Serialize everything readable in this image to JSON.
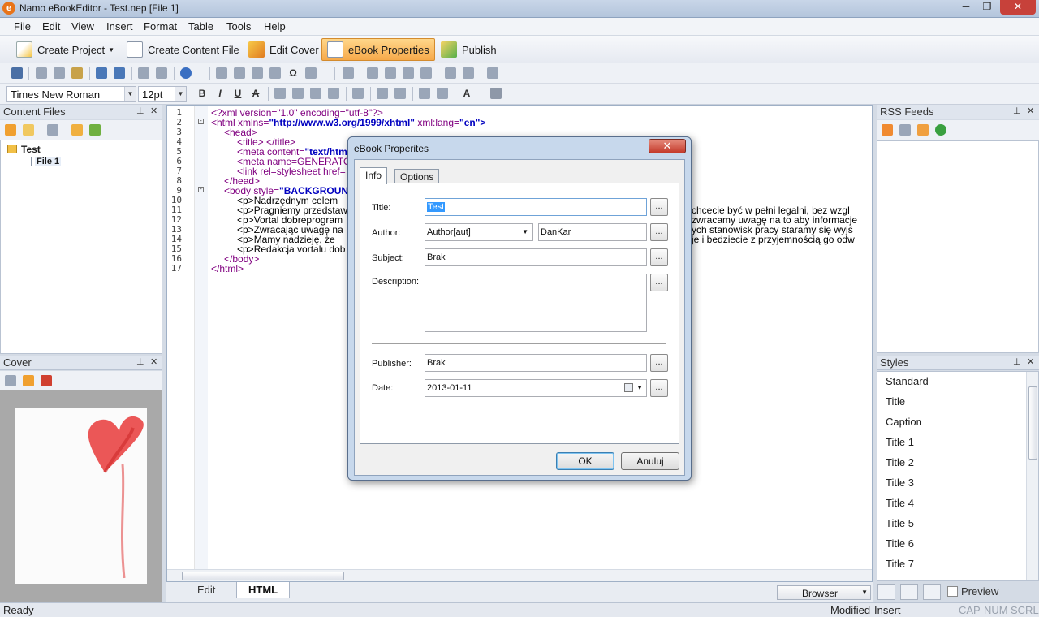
{
  "window": {
    "title": "Namo eBookEditor - Test.nep [File 1]",
    "app_icon_glyph": "e",
    "controls": [
      "─",
      "❐",
      "✕"
    ]
  },
  "menu": [
    "File",
    "Edit",
    "View",
    "Insert",
    "Format",
    "Table",
    "Tools",
    "Help"
  ],
  "toolbar": {
    "create_project": "Create Project",
    "create_content": "Create Content File",
    "edit_cover": "Edit Cover",
    "ebook_properties": "eBook Properties",
    "publish": "Publish"
  },
  "format": {
    "font": "Times New Roman",
    "size": "12pt",
    "bold": "B",
    "italic": "I",
    "underline": "U",
    "strike": "A",
    "text_color": "A"
  },
  "content_files": {
    "title": "Content Files",
    "project": "Test",
    "file": "File 1"
  },
  "cover": {
    "title": "Cover"
  },
  "rss": {
    "title": "RSS Feeds"
  },
  "styles": {
    "title": "Styles",
    "items": [
      "Standard",
      "Title",
      "Caption",
      "Title 1",
      "Title 2",
      "Title 3",
      "Title 4",
      "Title 5",
      "Title 6",
      "Title 7"
    ]
  },
  "editor": {
    "line_numbers": [
      "1",
      "2",
      "3",
      "4",
      "5",
      "6",
      "7",
      "8",
      "9",
      "10",
      "11",
      "12",
      "13",
      "14",
      "15",
      "16",
      "17"
    ],
    "line1": "<?xml version=\"1.0\" encoding=\"utf-8\"?>",
    "line2_a": "<html xmlns=",
    "line2_b": "\"http://www.w3.org/1999/xhtml\"",
    "line2_c": " xml:lang=",
    "line2_d": "\"en\">",
    "line3": "<head>",
    "line4": "<title> </title>",
    "line5_a": "<meta content=",
    "line5_b": "\"text/html",
    "line6": "<meta name=GENERATOR",
    "line7": "<link rel=stylesheet href=",
    "line8": "</head>",
    "line9_a": "<body style=",
    "line9_b": "\"BACKGROUND",
    "line10": "<p>Nadrzędnym celem",
    "line11": "<p>Pragniemy przedstaw",
    "line12": "<p>Vortal dobreprogram",
    "line13": "<p>Zwracając uwagę na",
    "line14": "<p>Mamy nadzieję, że",
    "line15": "<p>Redakcja vortalu dob",
    "line16": "</body>",
    "line17": "</html>",
    "r11": "chcecie być w pełni legalni, bez wzgl",
    "r12": "zwracamy uwagę na to aby informacje",
    "r13": "ych stanowisk pracy staramy się wyjś",
    "r14": "je i bedziecie z przyjemnością go odw"
  },
  "edit_tabs": {
    "edit": "Edit",
    "html": "HTML"
  },
  "bottom_right": {
    "browser": "Browser",
    "preview": "Preview"
  },
  "status": {
    "ready": "Ready",
    "modified": "Modified",
    "insert": "Insert",
    "cap": "CAP",
    "num": "NUM",
    "scrl": "SCRL"
  },
  "dialog": {
    "title": "eBook Properites",
    "close": "✕",
    "tabs": {
      "info": "Info",
      "options": "Options"
    },
    "labels": {
      "title": "Title:",
      "author": "Author:",
      "subject": "Subject:",
      "description": "Description:",
      "publisher": "Publisher:",
      "date": "Date:"
    },
    "values": {
      "title": "Test",
      "author_role": "Author[aut]",
      "author_name": "DanKar",
      "subject": "Brak",
      "description": "",
      "publisher": "Brak",
      "date": "2013-01-11"
    },
    "dots": "...",
    "ok": "OK",
    "cancel": "Anuluj"
  }
}
